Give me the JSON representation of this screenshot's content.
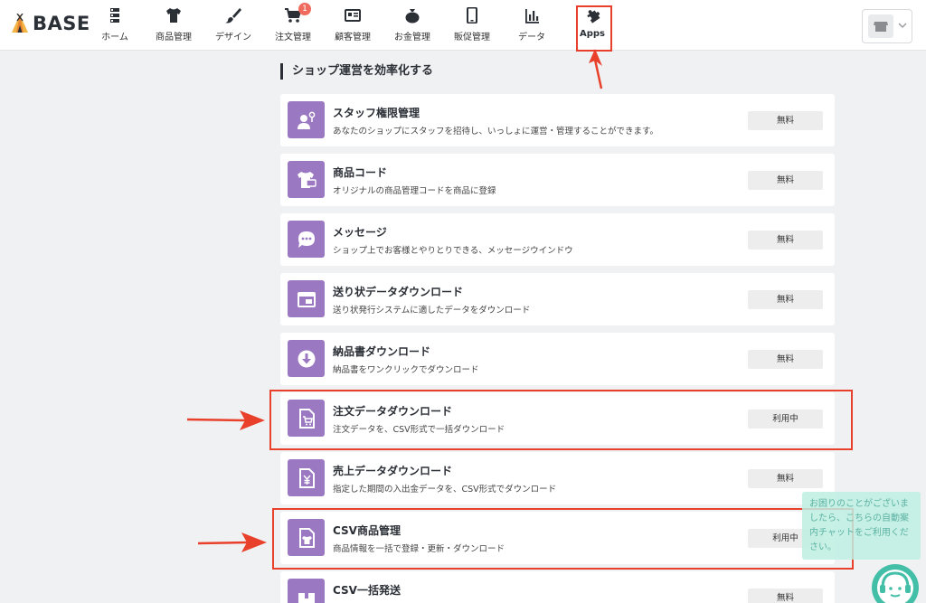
{
  "logo": {
    "text": "BASE"
  },
  "nav": {
    "items": [
      {
        "label": "ホーム",
        "icon": "home-list-icon"
      },
      {
        "label": "商品管理",
        "icon": "tshirt-icon"
      },
      {
        "label": "デザイン",
        "icon": "brush-icon"
      },
      {
        "label": "注文管理",
        "icon": "cart-icon",
        "badge": "1"
      },
      {
        "label": "顧客管理",
        "icon": "customer-card-icon"
      },
      {
        "label": "お金管理",
        "icon": "money-bag-icon"
      },
      {
        "label": "販促管理",
        "icon": "smartphone-icon"
      },
      {
        "label": "データ",
        "icon": "bar-chart-icon"
      },
      {
        "label": "Apps",
        "icon": "puzzle-icon"
      }
    ]
  },
  "section": {
    "title": "ショップ運営を効率化する"
  },
  "apps": [
    {
      "name": "スタッフ権限管理",
      "desc": "あなたのショップにスタッフを招待し、いっしょに運営・管理することができます。",
      "status": "無料",
      "icon": "staff-icon"
    },
    {
      "name": "商品コード",
      "desc": "オリジナルの商品管理コードを商品に登録",
      "status": "無料",
      "icon": "product-code-icon"
    },
    {
      "name": "メッセージ",
      "desc": "ショップ上でお客様とやりとりできる、メッセージウインドウ",
      "status": "無料",
      "icon": "chat-bubble-icon"
    },
    {
      "name": "送り状データダウンロード",
      "desc": "送り状発行システムに適したデータをダウンロード",
      "status": "無料",
      "icon": "invoice-icon"
    },
    {
      "name": "納品書ダウンロード",
      "desc": "納品書をワンクリックでダウンロード",
      "status": "無料",
      "icon": "download-icon"
    },
    {
      "name": "注文データダウンロード",
      "desc": "注文データを、CSV形式で一括ダウンロード",
      "status": "利用中",
      "icon": "order-data-icon"
    },
    {
      "name": "売上データダウンロード",
      "desc": "指定した期間の入出金データを、CSV形式でダウンロード",
      "status": "無料",
      "icon": "sales-data-icon"
    },
    {
      "name": "CSV商品管理",
      "desc": "商品情報を一括で登録・更新・ダウンロード",
      "status": "利用中",
      "icon": "csv-product-icon"
    },
    {
      "name": "CSV一括発送",
      "desc": "",
      "status": "無料",
      "icon": "csv-shipping-icon"
    }
  ],
  "help": {
    "text": "お困りのことがございましたら、こちらの自動案内チャットをご利用ください。"
  },
  "colors": {
    "accent": "#9b78c2",
    "highlight": "#e8402a",
    "help": "#43bfa8"
  }
}
